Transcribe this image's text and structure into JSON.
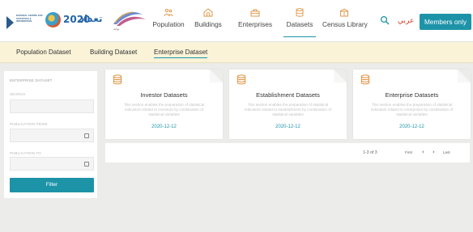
{
  "header": {
    "gov_logo_text": "NATIONAL CENTRE FOR STATISTICS & INFORMATION",
    "census_logo_year": "2020",
    "census_logo_arabic": "تعداد",
    "swoosh_logo_text": "بوابة",
    "nav": [
      {
        "label": "Population",
        "icon": "population-icon"
      },
      {
        "label": "Buildings",
        "icon": "buildings-icon"
      },
      {
        "label": "Enterprises",
        "icon": "enterprises-icon"
      },
      {
        "label": "Datasets",
        "icon": "datasets-icon",
        "active": true
      },
      {
        "label": "Census Library",
        "icon": "library-icon"
      }
    ],
    "language_label": "عربي",
    "members_label": "Members only",
    "accent_color": "#1d93a8",
    "nav_icon_color": "#e0903c"
  },
  "subnav": {
    "tabs": [
      {
        "label": "Population Dataset"
      },
      {
        "label": "Building Dataset"
      },
      {
        "label": "Enterprise Dataset",
        "active": true
      }
    ]
  },
  "sidebar": {
    "title": "ENTERPRISE DATASET",
    "search_label": "SEARCH",
    "search_value": "",
    "from_label": "PUBLICATION FROM",
    "from_value": "",
    "to_label": "PUBLICATION TO",
    "to_value": "",
    "filter_label": "Filter"
  },
  "cards": [
    {
      "title": "Investor Datasets",
      "description": "This section enables the preparation of statistical indicators related to investors by combination of statistical variables",
      "date": "2020-12-12"
    },
    {
      "title": "Establishment Datasets",
      "description": "This section enables the preparation of statistical indicators related to establishment by combination of statistical variables",
      "date": "2020-12-12"
    },
    {
      "title": "Enterprise Datasets",
      "description": "This section enables the preparation of statistical indicators related to enterprises by combination of statistical variables",
      "date": "2020-12-12"
    }
  ],
  "pagination": {
    "info": "1-3 of 3",
    "first_label": "First",
    "prev_label": "‹",
    "next_label": "›",
    "last_label": "Last"
  }
}
